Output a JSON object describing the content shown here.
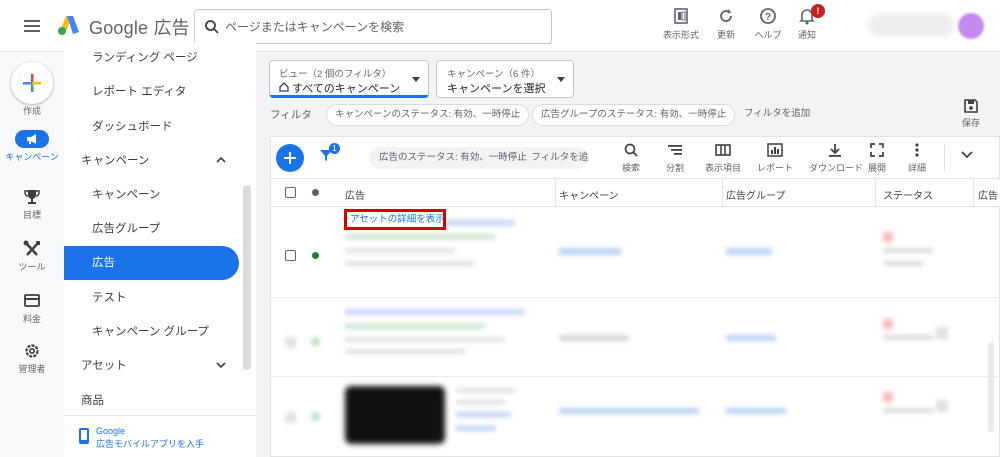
{
  "app": {
    "logo_text": "Google 広告",
    "search_placeholder": "ページまたはキャンペーンを検索"
  },
  "topbar_actions": [
    {
      "label": "表示形式",
      "icon": "appearance-icon"
    },
    {
      "label": "更新",
      "icon": "refresh-icon"
    },
    {
      "label": "ヘルプ",
      "icon": "help-icon"
    },
    {
      "label": "通知",
      "icon": "bell-icon",
      "badge": "!"
    }
  ],
  "rail": {
    "create": "作成",
    "campaigns": "キャンペーン",
    "goals": "目標",
    "tools": "ツール",
    "billing": "料金",
    "admin": "管理者"
  },
  "sidenav": {
    "items": [
      {
        "label": "ランディング ページ"
      },
      {
        "label": "レポート エディタ"
      },
      {
        "label": "ダッシュボード"
      },
      {
        "label": "キャンペーン"
      },
      {
        "label": "キャンペーン"
      },
      {
        "label": "広告グループ"
      },
      {
        "label": "広告",
        "active": true
      },
      {
        "label": "テスト"
      },
      {
        "label": "キャンペーン グループ"
      },
      {
        "label": "アセット"
      },
      {
        "label": "商品"
      }
    ],
    "footer_line1": "Google",
    "footer_line2": "広告モバイルアプリを入手"
  },
  "view_selector": {
    "label": "ビュー（2 個のフィルタ）",
    "value": "すべてのキャンペーン"
  },
  "campaign_selector": {
    "label": "キャンペーン（6 件）",
    "value": "キャンペーンを選択"
  },
  "filters": {
    "label": "フィルタ",
    "chips": [
      "キャンペーンのステータス: 有効、一時停止",
      "広告グループのステータス: 有効、一時停止",
      "フィルタを追加"
    ],
    "save_label": "保存"
  },
  "toolbar": {
    "filter_badge": "1",
    "filter_text": "広告のステータス: 有効、一時停止",
    "filter_add": "フィルタを追加",
    "buttons": [
      {
        "label": "検索",
        "icon": "search-icon"
      },
      {
        "label": "分割",
        "icon": "segment-icon"
      },
      {
        "label": "表示項目",
        "icon": "columns-icon"
      },
      {
        "label": "レポート",
        "icon": "report-icon"
      },
      {
        "label": "ダウンロード",
        "icon": "download-icon"
      },
      {
        "label": "展開",
        "icon": "expand-icon"
      },
      {
        "label": "詳細",
        "icon": "more-icon"
      }
    ]
  },
  "table": {
    "columns": [
      "広告",
      "キャンペーン",
      "広告グループ",
      "ステータス",
      "広告"
    ],
    "asset_detail_link": "アセットの詳細を表示"
  },
  "colors": {
    "accent": "#1a73e8",
    "status_green": "#188038",
    "highlight_red": "#d50000"
  }
}
